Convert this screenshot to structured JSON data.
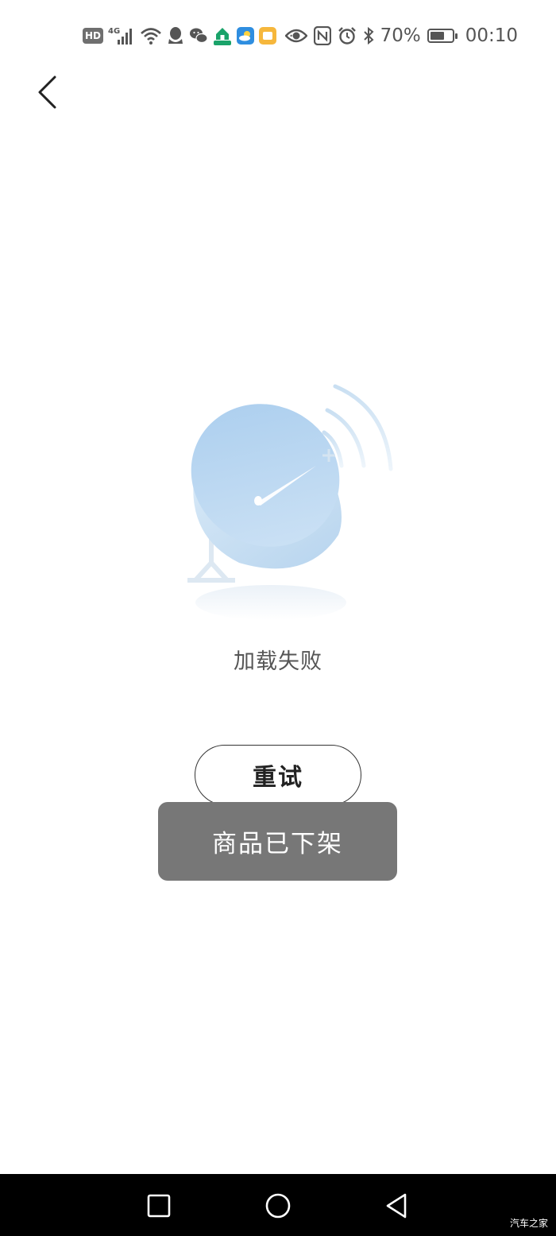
{
  "status_bar": {
    "hd_label": "HD",
    "network_label": "4G",
    "battery_percent": "70%",
    "battery_level": 0.7,
    "time": "00:10",
    "more_dots": "···",
    "icons": [
      "hd-icon",
      "signal-icon",
      "wifi-icon",
      "qq-icon",
      "wechat-icon",
      "home-app-icon",
      "weather-app-icon",
      "notes-app-icon",
      "eye-icon",
      "nfc-icon",
      "alarm-icon",
      "bluetooth-icon",
      "battery-icon"
    ]
  },
  "header": {
    "back_icon": "chevron-left-icon"
  },
  "main": {
    "illustration_icon": "satellite-dish-icon",
    "status_text": "加载失败",
    "retry_label": "重试"
  },
  "toast": {
    "message": "商品已下架"
  },
  "nav_bar": {
    "buttons": [
      "recent-apps-icon",
      "home-icon",
      "back-icon"
    ],
    "watermark": "汽车之家"
  },
  "colors": {
    "dish_blue": "#b9d6ef",
    "toast_bg": "#777777",
    "nav_bg": "#000000"
  }
}
